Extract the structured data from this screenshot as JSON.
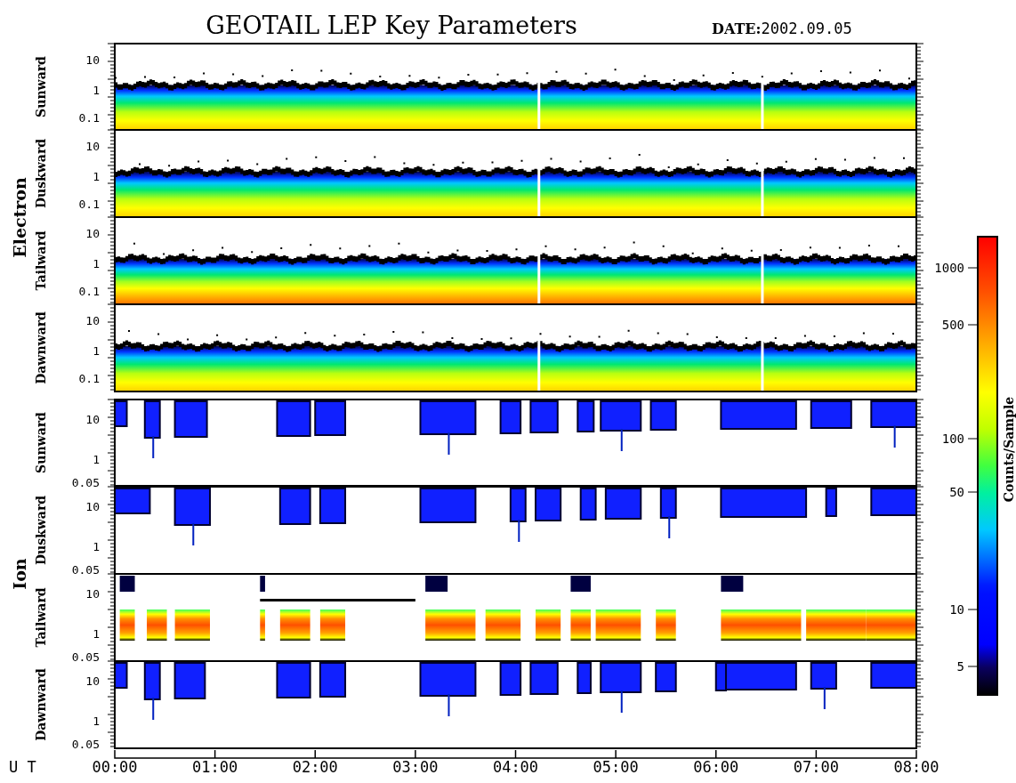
{
  "title": "GEOTAIL LEP Key Parameters",
  "date_label": "DATE:",
  "date": "2002.09.05",
  "groups": [
    {
      "kind": "electron",
      "label": "Electron",
      "panels": [
        {
          "label": "Sunward",
          "yticks": [
            "10",
            "1",
            "0.1"
          ]
        },
        {
          "label": "Duskward",
          "yticks": [
            "10",
            "1",
            "0.1"
          ]
        },
        {
          "label": "Tailward",
          "yticks": [
            "10",
            "1",
            "0.1"
          ]
        },
        {
          "label": "Dawnward",
          "yticks": [
            "10",
            "1",
            "0.1"
          ]
        }
      ]
    },
    {
      "kind": "ion",
      "label": "Ion",
      "panels": [
        {
          "label": "Sunward",
          "yticks": [
            "10",
            "1",
            "0.05"
          ]
        },
        {
          "label": "Duskward",
          "yticks": [
            "10",
            "1",
            "0.05"
          ]
        },
        {
          "label": "Tailward",
          "yticks": [
            "10",
            "1",
            "0.05"
          ]
        },
        {
          "label": "Dawnward",
          "yticks": [
            "10",
            "1",
            "0.05"
          ]
        }
      ]
    }
  ],
  "x_axis": {
    "label": "U T",
    "ticks": [
      "00:00",
      "01:00",
      "02:00",
      "03:00",
      "04:00",
      "05:00",
      "06:00",
      "07:00",
      "08:00"
    ]
  },
  "colorbar": {
    "label": "Counts/Sample",
    "ticks": [
      "1000",
      "500",
      "100",
      "50",
      "10",
      "5"
    ]
  }
}
